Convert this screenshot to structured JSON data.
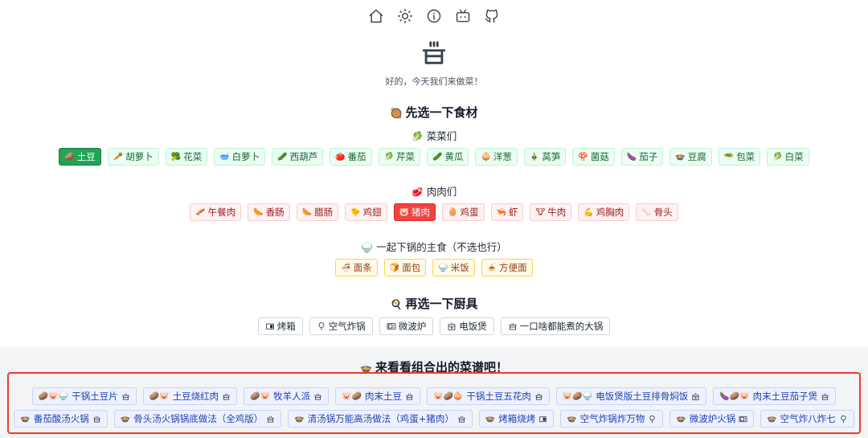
{
  "nav": [
    "home-icon",
    "sun-icon",
    "info-icon",
    "tv-icon",
    "github-icon"
  ],
  "subtitle": "好的，今天我们来做菜！",
  "section1": {
    "emoji": "🥘",
    "title": "先选一下食材"
  },
  "veg": {
    "title_emoji": "🥬",
    "title": "菜菜们",
    "items": [
      {
        "e": "🥔",
        "label": "土豆",
        "on": true
      },
      {
        "e": "🥕",
        "label": "胡萝卜"
      },
      {
        "e": "🥦",
        "label": "花菜"
      },
      {
        "e": "🥣",
        "label": "白萝卜"
      },
      {
        "e": "🥒",
        "label": "西葫芦"
      },
      {
        "e": "🍅",
        "label": "番茄"
      },
      {
        "e": "🥬",
        "label": "芹菜"
      },
      {
        "e": "🥒",
        "label": "黄瓜"
      },
      {
        "e": "🧅",
        "label": "洋葱"
      },
      {
        "e": "🎍",
        "label": "莴笋"
      },
      {
        "e": "🍄",
        "label": "菌菇"
      },
      {
        "e": "🍆",
        "label": "茄子"
      },
      {
        "e": "🍲",
        "label": "豆腐"
      },
      {
        "e": "🥗",
        "label": "包菜"
      },
      {
        "e": "🥬",
        "label": "白菜"
      }
    ]
  },
  "meat": {
    "title_emoji": "🥩",
    "title": "肉肉们",
    "items": [
      {
        "e": "🥓",
        "label": "午餐肉"
      },
      {
        "e": "🌭",
        "label": "香肠"
      },
      {
        "e": "🌭",
        "label": "腊肠"
      },
      {
        "e": "🐤",
        "label": "鸡翅"
      },
      {
        "e": "🐷",
        "label": "猪肉",
        "on": true
      },
      {
        "e": "🥚",
        "label": "鸡蛋"
      },
      {
        "e": "🦐",
        "label": "虾"
      },
      {
        "e": "🐮",
        "label": "牛肉"
      },
      {
        "e": "💪",
        "label": "鸡胸肉"
      },
      {
        "e": "🦴",
        "label": "骨头"
      }
    ]
  },
  "staple": {
    "title_emoji": "🍚",
    "title": "一起下锅的主食（不选也行）",
    "items": [
      {
        "e": "🍜",
        "label": "面条"
      },
      {
        "e": "🍞",
        "label": "面包"
      },
      {
        "e": "🍚",
        "label": "米饭"
      },
      {
        "e": "🍝",
        "label": "方便面"
      }
    ]
  },
  "section2": {
    "emoji": "🍳",
    "title": "再选一下厨具"
  },
  "tools": [
    {
      "icon": "oven-icon",
      "label": "烤箱"
    },
    {
      "icon": "air-fryer-icon",
      "label": "空气炸锅"
    },
    {
      "icon": "microwave-icon",
      "label": "微波炉"
    },
    {
      "icon": "rice-cooker-icon",
      "label": "电饭煲"
    },
    {
      "icon": "pot-icon",
      "label": "一口啥都能煮的大锅"
    }
  ],
  "section3": {
    "emoji": "🍲",
    "title": "来看看组合出的菜谱吧！"
  },
  "recipes_row1": [
    {
      "e": "🥔🐷🍚",
      "label": "干锅土豆片",
      "icon": "pot-icon"
    },
    {
      "e": "🥔🐷",
      "label": "土豆烧红肉",
      "icon": "pot-icon"
    },
    {
      "e": "🥔🐷",
      "label": "牧羊人派",
      "icon": "pot-icon"
    },
    {
      "e": "🐷🥔",
      "label": "肉末土豆",
      "icon": "pot-icon"
    },
    {
      "e": "🐷🥔🧅",
      "label": "干锅土豆五花肉",
      "icon": "pot-icon"
    },
    {
      "e": "🐷🥔🍚",
      "label": "电饭煲版土豆排骨焖饭",
      "icon": "rice-cooker-icon"
    },
    {
      "e": "🍆🥔🐷",
      "label": "肉末土豆茄子煲",
      "icon": "pot-icon"
    }
  ],
  "recipes_row2": [
    {
      "e": "🍲",
      "label": "番茄酸汤火锅",
      "icon": "pot-icon"
    },
    {
      "e": "🍲",
      "label": "骨头汤火锅锅底做法（全鸡版）",
      "icon": "pot-icon"
    },
    {
      "e": "🍲",
      "label": "清汤锅万能高汤做法（鸡蛋+猪肉）",
      "icon": "pot-icon"
    },
    {
      "e": "🍲",
      "label": "烤箱烧烤",
      "icon": "oven-icon"
    },
    {
      "e": "🍲",
      "label": "空气炸锅炸万物",
      "icon": "air-fryer-icon"
    },
    {
      "e": "🍲",
      "label": "微波炉火锅",
      "icon": "microwave-icon"
    },
    {
      "e": "🍲",
      "label": "空气炸八炸七",
      "icon": "air-fryer-icon"
    }
  ]
}
